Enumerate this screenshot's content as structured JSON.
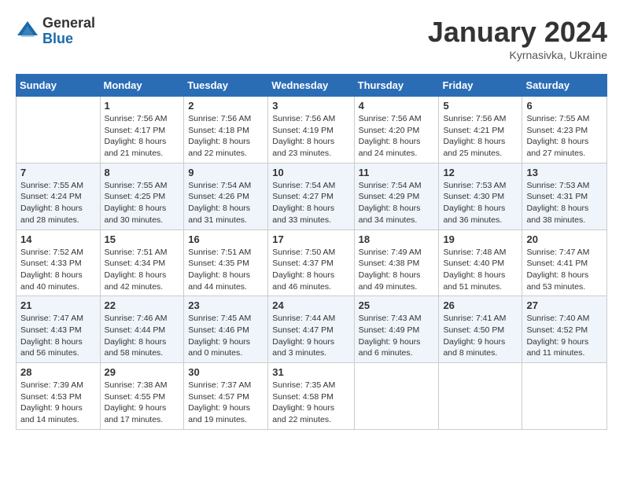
{
  "header": {
    "logo_general": "General",
    "logo_blue": "Blue",
    "month_title": "January 2024",
    "location": "Kyrnasivka, Ukraine"
  },
  "weekdays": [
    "Sunday",
    "Monday",
    "Tuesday",
    "Wednesday",
    "Thursday",
    "Friday",
    "Saturday"
  ],
  "weeks": [
    [
      {
        "day": "",
        "info": ""
      },
      {
        "day": "1",
        "info": "Sunrise: 7:56 AM\nSunset: 4:17 PM\nDaylight: 8 hours\nand 21 minutes."
      },
      {
        "day": "2",
        "info": "Sunrise: 7:56 AM\nSunset: 4:18 PM\nDaylight: 8 hours\nand 22 minutes."
      },
      {
        "day": "3",
        "info": "Sunrise: 7:56 AM\nSunset: 4:19 PM\nDaylight: 8 hours\nand 23 minutes."
      },
      {
        "day": "4",
        "info": "Sunrise: 7:56 AM\nSunset: 4:20 PM\nDaylight: 8 hours\nand 24 minutes."
      },
      {
        "day": "5",
        "info": "Sunrise: 7:56 AM\nSunset: 4:21 PM\nDaylight: 8 hours\nand 25 minutes."
      },
      {
        "day": "6",
        "info": "Sunrise: 7:55 AM\nSunset: 4:23 PM\nDaylight: 8 hours\nand 27 minutes."
      }
    ],
    [
      {
        "day": "7",
        "info": "Sunrise: 7:55 AM\nSunset: 4:24 PM\nDaylight: 8 hours\nand 28 minutes."
      },
      {
        "day": "8",
        "info": "Sunrise: 7:55 AM\nSunset: 4:25 PM\nDaylight: 8 hours\nand 30 minutes."
      },
      {
        "day": "9",
        "info": "Sunrise: 7:54 AM\nSunset: 4:26 PM\nDaylight: 8 hours\nand 31 minutes."
      },
      {
        "day": "10",
        "info": "Sunrise: 7:54 AM\nSunset: 4:27 PM\nDaylight: 8 hours\nand 33 minutes."
      },
      {
        "day": "11",
        "info": "Sunrise: 7:54 AM\nSunset: 4:29 PM\nDaylight: 8 hours\nand 34 minutes."
      },
      {
        "day": "12",
        "info": "Sunrise: 7:53 AM\nSunset: 4:30 PM\nDaylight: 8 hours\nand 36 minutes."
      },
      {
        "day": "13",
        "info": "Sunrise: 7:53 AM\nSunset: 4:31 PM\nDaylight: 8 hours\nand 38 minutes."
      }
    ],
    [
      {
        "day": "14",
        "info": "Sunrise: 7:52 AM\nSunset: 4:33 PM\nDaylight: 8 hours\nand 40 minutes."
      },
      {
        "day": "15",
        "info": "Sunrise: 7:51 AM\nSunset: 4:34 PM\nDaylight: 8 hours\nand 42 minutes."
      },
      {
        "day": "16",
        "info": "Sunrise: 7:51 AM\nSunset: 4:35 PM\nDaylight: 8 hours\nand 44 minutes."
      },
      {
        "day": "17",
        "info": "Sunrise: 7:50 AM\nSunset: 4:37 PM\nDaylight: 8 hours\nand 46 minutes."
      },
      {
        "day": "18",
        "info": "Sunrise: 7:49 AM\nSunset: 4:38 PM\nDaylight: 8 hours\nand 49 minutes."
      },
      {
        "day": "19",
        "info": "Sunrise: 7:48 AM\nSunset: 4:40 PM\nDaylight: 8 hours\nand 51 minutes."
      },
      {
        "day": "20",
        "info": "Sunrise: 7:47 AM\nSunset: 4:41 PM\nDaylight: 8 hours\nand 53 minutes."
      }
    ],
    [
      {
        "day": "21",
        "info": "Sunrise: 7:47 AM\nSunset: 4:43 PM\nDaylight: 8 hours\nand 56 minutes."
      },
      {
        "day": "22",
        "info": "Sunrise: 7:46 AM\nSunset: 4:44 PM\nDaylight: 8 hours\nand 58 minutes."
      },
      {
        "day": "23",
        "info": "Sunrise: 7:45 AM\nSunset: 4:46 PM\nDaylight: 9 hours\nand 0 minutes."
      },
      {
        "day": "24",
        "info": "Sunrise: 7:44 AM\nSunset: 4:47 PM\nDaylight: 9 hours\nand 3 minutes."
      },
      {
        "day": "25",
        "info": "Sunrise: 7:43 AM\nSunset: 4:49 PM\nDaylight: 9 hours\nand 6 minutes."
      },
      {
        "day": "26",
        "info": "Sunrise: 7:41 AM\nSunset: 4:50 PM\nDaylight: 9 hours\nand 8 minutes."
      },
      {
        "day": "27",
        "info": "Sunrise: 7:40 AM\nSunset: 4:52 PM\nDaylight: 9 hours\nand 11 minutes."
      }
    ],
    [
      {
        "day": "28",
        "info": "Sunrise: 7:39 AM\nSunset: 4:53 PM\nDaylight: 9 hours\nand 14 minutes."
      },
      {
        "day": "29",
        "info": "Sunrise: 7:38 AM\nSunset: 4:55 PM\nDaylight: 9 hours\nand 17 minutes."
      },
      {
        "day": "30",
        "info": "Sunrise: 7:37 AM\nSunset: 4:57 PM\nDaylight: 9 hours\nand 19 minutes."
      },
      {
        "day": "31",
        "info": "Sunrise: 7:35 AM\nSunset: 4:58 PM\nDaylight: 9 hours\nand 22 minutes."
      },
      {
        "day": "",
        "info": ""
      },
      {
        "day": "",
        "info": ""
      },
      {
        "day": "",
        "info": ""
      }
    ]
  ]
}
